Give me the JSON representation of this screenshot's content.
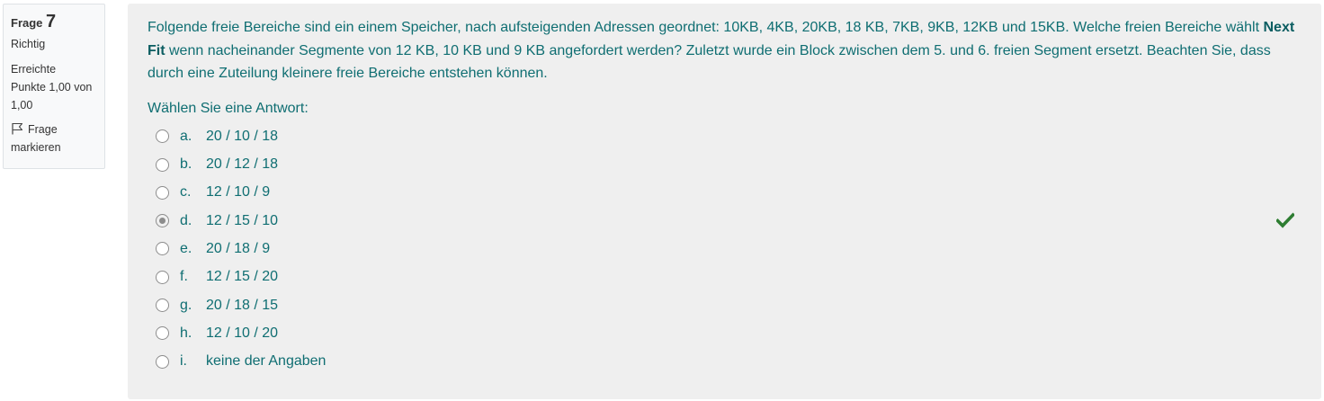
{
  "info": {
    "question_label": "Frage",
    "question_number": "7",
    "state": "Richtig",
    "grade_line1": "Erreichte",
    "grade_line2": "Punkte 1,00 von",
    "grade_line3": "1,00",
    "flag_line1": "Frage",
    "flag_line2": "markieren"
  },
  "question": {
    "text_part1": "Folgende freie Bereiche sind ein einem Speicher, nach aufsteigenden Adressen geordnet: 10KB, 4KB, 20KB, 18 KB, 7KB, 9KB, 12KB und 15KB. Welche freien Bereiche wählt ",
    "bold_term": "Next Fit",
    "text_part2": " wenn nacheinander Segmente von 12 KB, 10 KB und 9 KB angefordert werden? Zuletzt wurde ein Block zwischen dem 5. und 6. freien Segment ersetzt. Beachten Sie, dass durch eine Zuteilung kleinere freie Bereiche entstehen können.",
    "prompt": "Wählen Sie eine Antwort:"
  },
  "answers": [
    {
      "letter": "a.",
      "text": "20 / 10 / 18",
      "selected": false
    },
    {
      "letter": "b.",
      "text": "20 / 12 / 18",
      "selected": false
    },
    {
      "letter": "c.",
      "text": "12 / 10 / 9",
      "selected": false
    },
    {
      "letter": "d.",
      "text": "12 / 15 / 10",
      "selected": true,
      "correct": true
    },
    {
      "letter": "e.",
      "text": "20 / 18 / 9",
      "selected": false
    },
    {
      "letter": "f.",
      "text": "12 / 15 / 20",
      "selected": false
    },
    {
      "letter": "g.",
      "text": "20 / 18 / 15",
      "selected": false
    },
    {
      "letter": "h.",
      "text": "12 / 10 / 20",
      "selected": false
    },
    {
      "letter": "i.",
      "text": "keine der Angaben",
      "selected": false
    }
  ],
  "icons": {
    "flag": "flag-icon",
    "correct": "checkmark-icon"
  },
  "colors": {
    "text": "#0f6e72",
    "correct_green": "#2e7d32"
  }
}
